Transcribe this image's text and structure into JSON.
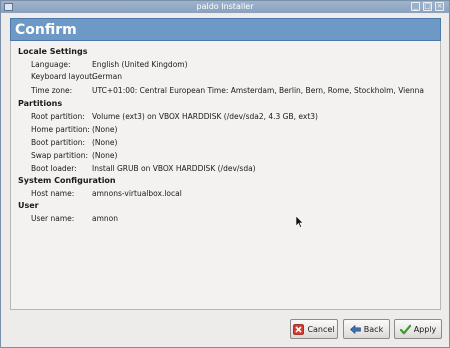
{
  "window": {
    "title": "paldo Installer"
  },
  "page": {
    "heading": "Confirm"
  },
  "sections": {
    "locale": {
      "title": "Locale Settings",
      "language_label": "Language:",
      "language_value": "English (United Kingdom)",
      "keyboard_label": "Keyboard layout:",
      "keyboard_value": "German",
      "timezone_label": "Time zone:",
      "timezone_value": "UTC+01:00: Central European Time: Amsterdam, Berlin, Bern, Rome, Stockholm, Vienna"
    },
    "partitions": {
      "title": "Partitions",
      "root_label": "Root partition:",
      "root_value": "Volume (ext3) on VBOX HARDDISK (/dev/sda2, 4.3 GB, ext3)",
      "home_label": "Home partition:",
      "home_value": "(None)",
      "boot_label": "Boot partition:",
      "boot_value": "(None)",
      "swap_label": "Swap partition:",
      "swap_value": "(None)",
      "loader_label": "Boot loader:",
      "loader_value": "Install GRUB on VBOX HARDDISK (/dev/sda)"
    },
    "system": {
      "title": "System Configuration",
      "host_label": "Host name:",
      "host_value": "amnons-virtualbox.local"
    },
    "user": {
      "title": "User",
      "user_label": "User name:",
      "user_value": "amnon"
    }
  },
  "buttons": {
    "cancel_label": "Cancel",
    "back_label": "Back",
    "apply_label": "Apply"
  },
  "colors": {
    "banner": "#6e99c7",
    "titlebar": "#8aa1bd"
  }
}
